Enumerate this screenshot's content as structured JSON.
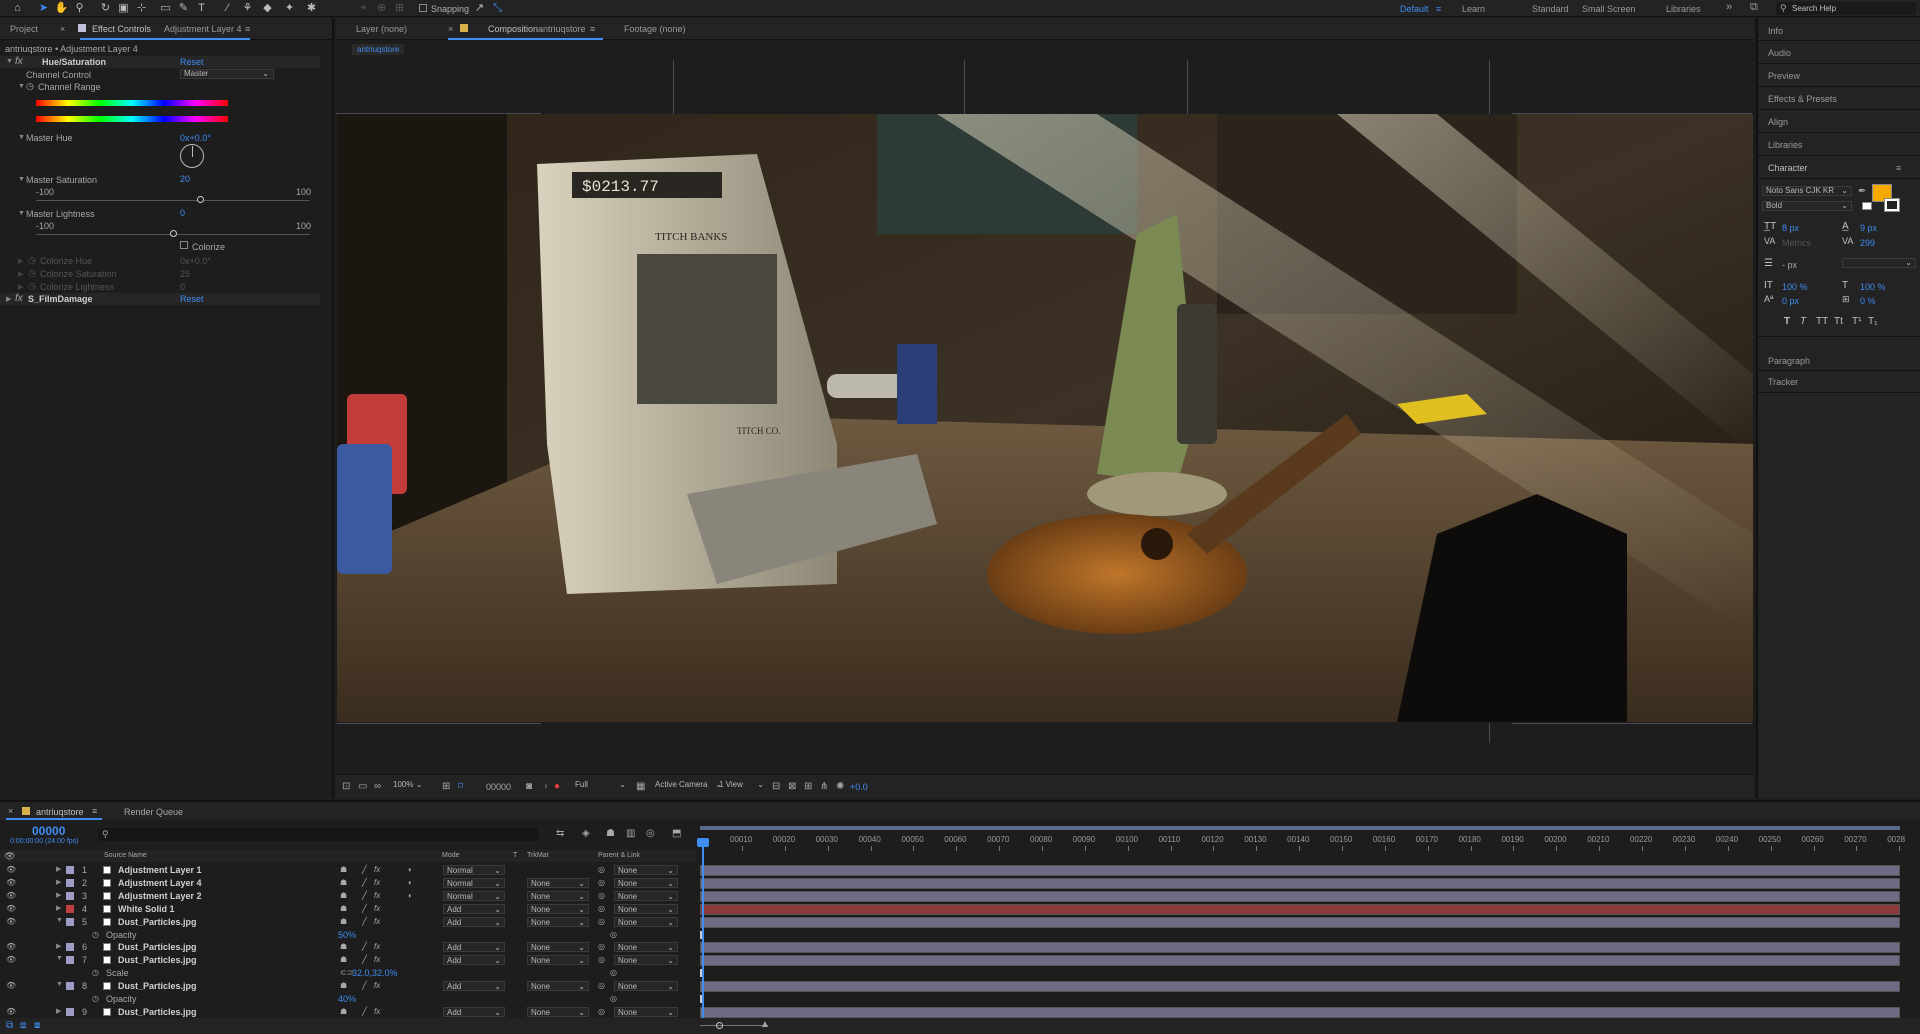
{
  "toolbar": {
    "snapping": "Snapping",
    "workspaces": [
      "Default",
      "Learn",
      "Standard",
      "Small Screen",
      "Libraries"
    ],
    "search_placeholder": "Search Help"
  },
  "effect_panel": {
    "tab_project": "Project",
    "tab_effect_controls_prefix": "Effect Controls",
    "tab_effect_controls_layer": "Adjustment Layer 4",
    "breadcrumb": "antriuqstore • Adjustment Layer 4",
    "hue_sat": {
      "name": "Hue/Saturation",
      "reset": "Reset",
      "channel_control_label": "Channel Control",
      "channel_control_value": "Master",
      "channel_range_label": "Channel Range",
      "master_hue_label": "Master Hue",
      "master_hue_value": "0x+0.0°",
      "master_saturation_label": "Master Saturation",
      "master_saturation_value": "20",
      "sat_min": "-100",
      "sat_max": "100",
      "master_lightness_label": "Master Lightness",
      "master_lightness_value": "0",
      "light_min": "-100",
      "light_max": "100",
      "colorize_label": "Colorize",
      "colorize_hue_label": "Colorize Hue",
      "colorize_hue_value": "0x+0.0°",
      "colorize_sat_label": "Colorize Saturation",
      "colorize_sat_value": "25",
      "colorize_light_label": "Colorize Lightness",
      "colorize_light_value": "0"
    },
    "film_damage": {
      "name": "S_FilmDamage",
      "reset": "Reset"
    }
  },
  "viewer": {
    "tab_layer": "Layer (none)",
    "tab_comp_prefix": "Composition",
    "tab_comp_name": "antriuqstore",
    "tab_footage": "Footage (none)",
    "comp_chip": "antriuqstore",
    "zoom": "100%",
    "timecode": "00000",
    "resolution": "Full",
    "camera": "Active Camera",
    "views": "1 View",
    "exposure": "+0.0"
  },
  "right_panel": {
    "items_top": [
      "Info",
      "Audio",
      "Preview",
      "Effects & Presets",
      "Align",
      "Libraries"
    ],
    "character_title": "Character",
    "font_family": "Noto Sans CJK KR",
    "font_style": "Bold",
    "font_size": "8 px",
    "leading": "9 px",
    "kerning": "Metrics",
    "tracking": "299",
    "stroke": "- px",
    "vscale": "100 %",
    "hscale": "100 %",
    "baseline": "0 px",
    "tsume": "0 %",
    "type_styles": [
      "T",
      "T",
      "TT",
      "Tt",
      "T¹",
      "T₁"
    ],
    "items_bottom": [
      "Paragraph",
      "Tracker"
    ],
    "fill_color": "#f5a800"
  },
  "timeline": {
    "tab_comp": "antriuqstore",
    "tab_render": "Render Queue",
    "timecode": "00000",
    "timecode_sub": "0:00:00:00 (24.00 fps)",
    "col_source": "Source Name",
    "col_mode": "Mode",
    "col_t": "T",
    "col_trkmat": "TrkMat",
    "col_parent": "Parent & Link",
    "ruler": [
      "00010",
      "00020",
      "00030",
      "00040",
      "00050",
      "00060",
      "00070",
      "00080",
      "00090",
      "00100",
      "00110",
      "00120",
      "00130",
      "00140",
      "00150",
      "00160",
      "00170",
      "00180",
      "00190",
      "00200",
      "00210",
      "00220",
      "00230",
      "00240",
      "00250",
      "00260",
      "00270",
      "0028"
    ],
    "layers": [
      {
        "num": "1",
        "name": "Adjustment Layer 1",
        "mode": "Normal",
        "trkmat": "",
        "parent": "None",
        "color": "#9c9cc4",
        "bar": "#6d6c84"
      },
      {
        "num": "2",
        "name": "Adjustment Layer 4",
        "mode": "Normal",
        "trkmat": "None",
        "parent": "None",
        "color": "#9c9cc4",
        "bar": "#6d6c84"
      },
      {
        "num": "3",
        "name": "Adjustment Layer 2",
        "mode": "Normal",
        "trkmat": "None",
        "parent": "None",
        "color": "#9c9cc4",
        "bar": "#6d6c84"
      },
      {
        "num": "4",
        "name": "White Solid 1",
        "mode": "Add",
        "trkmat": "None",
        "parent": "None",
        "color": "#c04040",
        "bar": "#8a3a3a"
      },
      {
        "num": "5",
        "name": "Dust_Particles.jpg",
        "mode": "Add",
        "trkmat": "None",
        "parent": "None",
        "color": "#9c9cc4",
        "bar": "#6d6c84",
        "prop": "Opacity",
        "prop_value": "50%"
      },
      {
        "num": "6",
        "name": "Dust_Particles.jpg",
        "mode": "Add",
        "trkmat": "None",
        "parent": "None",
        "color": "#9c9cc4",
        "bar": "#6d6c84"
      },
      {
        "num": "7",
        "name": "Dust_Particles.jpg",
        "mode": "Add",
        "trkmat": "None",
        "parent": "None",
        "color": "#9c9cc4",
        "bar": "#6d6c84",
        "prop": "Scale",
        "prop_value": "32.0,32.0%"
      },
      {
        "num": "8",
        "name": "Dust_Particles.jpg",
        "mode": "Add",
        "trkmat": "None",
        "parent": "None",
        "color": "#9c9cc4",
        "bar": "#6d6c84",
        "prop": "Opacity",
        "prop_value": "40%"
      },
      {
        "num": "9",
        "name": "Dust_Particles.jpg",
        "mode": "Add",
        "trkmat": "None",
        "parent": "None",
        "color": "#9c9cc4",
        "bar": "#6d6c84"
      }
    ]
  },
  "scene": {
    "register_display": "$0213.77",
    "brand": "TITCH BANKS",
    "company": "TITCH CO."
  }
}
